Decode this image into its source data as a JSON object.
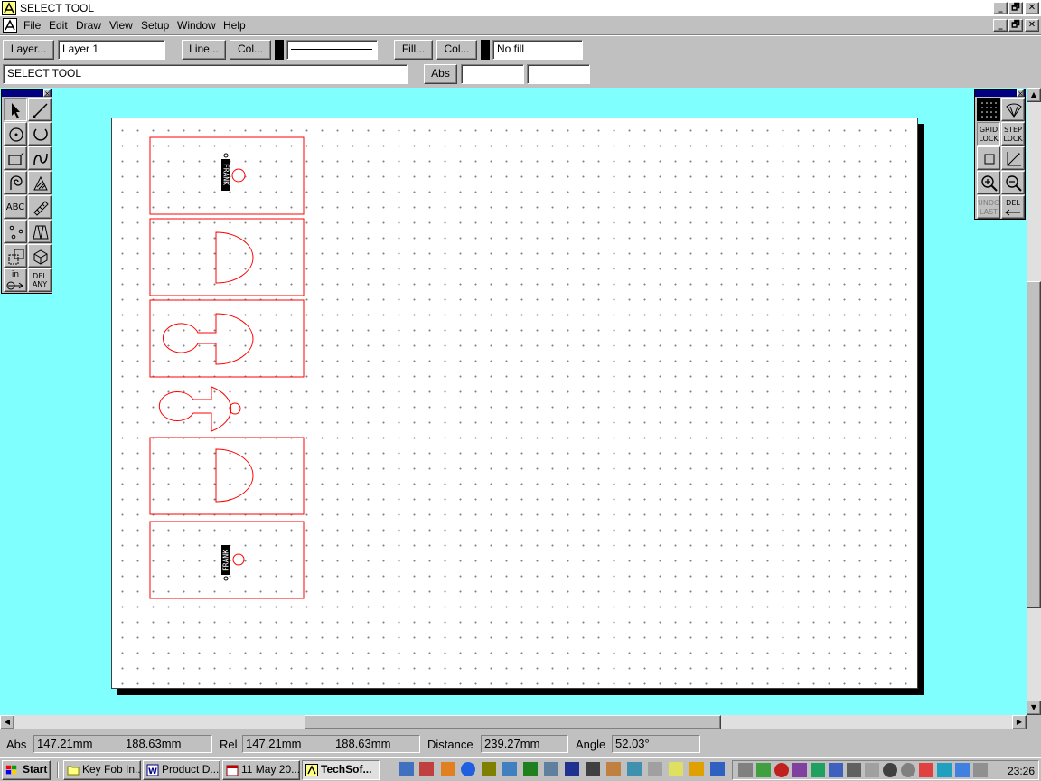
{
  "window": {
    "title": "SELECT TOOL",
    "controls": {
      "minimize": "_",
      "restore": "🗗",
      "close": "✕"
    }
  },
  "menu": [
    "File",
    "Edit",
    "Draw",
    "View",
    "Setup",
    "Window",
    "Help"
  ],
  "toolbar": {
    "layer_button": "Layer...",
    "layer_value": "Layer 1",
    "line_button": "Line...",
    "line_color_button": "Col...",
    "fill_button": "Fill...",
    "fill_color_button": "Col...",
    "fill_value": "No fill",
    "status_text": "SELECT TOOL",
    "abs_button": "Abs",
    "coord_x": "",
    "coord_y": ""
  },
  "left_palette": {
    "text_tool": "ABC",
    "units_tool": "in",
    "delete_any": [
      "DEL",
      "ANY"
    ]
  },
  "right_palette": {
    "grid_lock": [
      "GRID",
      "LOCK"
    ],
    "step_lock": [
      "STEP",
      "LOCK"
    ],
    "undo_last": [
      "UNDO",
      "LAST"
    ],
    "delete": "DEL"
  },
  "drawing": {
    "stroke_color": "#ff0000",
    "workspace_color": "#80ffff",
    "engraved_text": "FRANK"
  },
  "status": {
    "abs_label": "Abs",
    "abs_x": "147.21mm",
    "abs_y": "188.63mm",
    "rel_label": "Rel",
    "rel_x": "147.21mm",
    "rel_y": "188.63mm",
    "distance_label": "Distance",
    "distance_value": "239.27mm",
    "angle_label": "Angle",
    "angle_value": "52.03°"
  },
  "taskbar": {
    "start": "Start",
    "tasks": [
      "Key Fob In...",
      "Product D...",
      "11 May 20...",
      "TechSof..."
    ],
    "clock": "23:26"
  }
}
